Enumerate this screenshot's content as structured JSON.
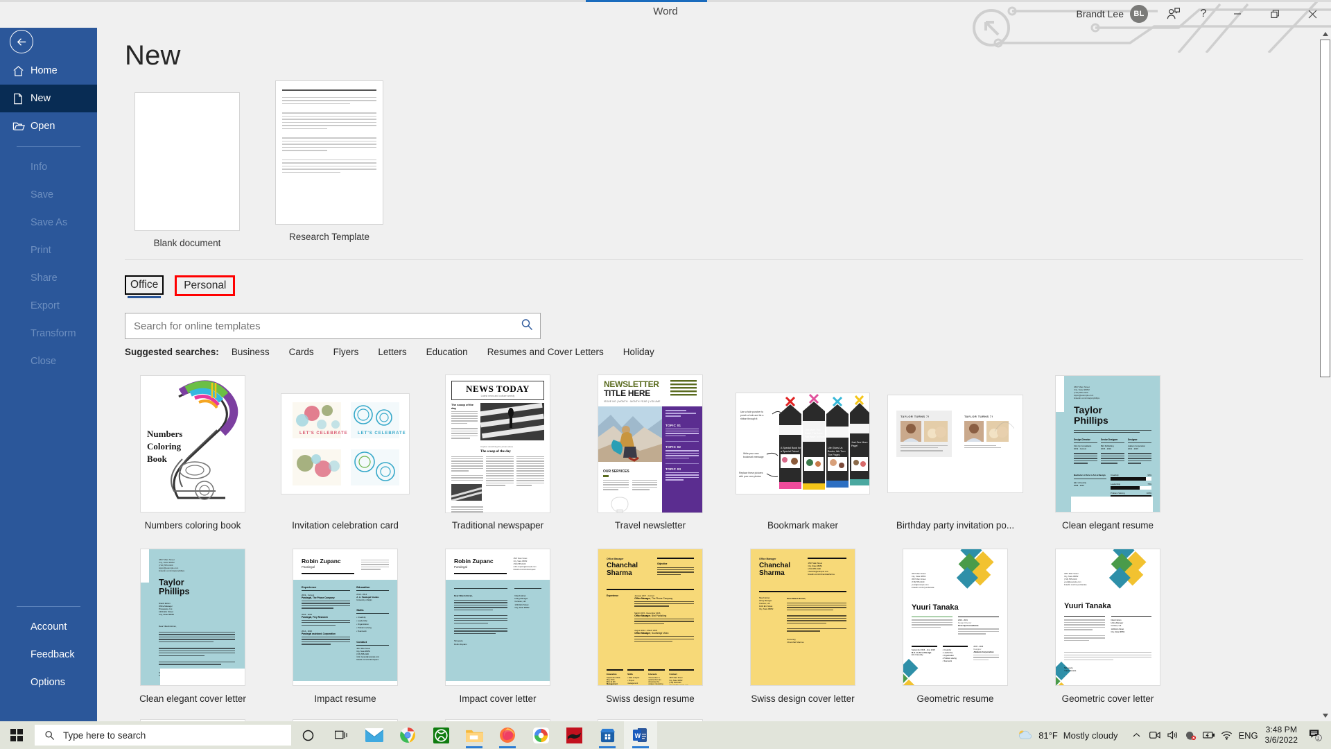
{
  "titlebar": {
    "app_title": "Word",
    "user_name": "Brandt Lee",
    "avatar_initials": "BL",
    "share_icon": "person-add-icon",
    "help_label": "?",
    "minimize_label": "—",
    "restore_label": "❐",
    "close_label": "✕"
  },
  "nav": {
    "back_icon": "back-arrow-icon",
    "items": [
      {
        "label": "Home",
        "icon": "home-icon",
        "state": "enabled"
      },
      {
        "label": "New",
        "icon": "new-document-icon",
        "state": "active"
      },
      {
        "label": "Open",
        "icon": "open-folder-icon",
        "state": "enabled"
      }
    ],
    "dim_items": [
      {
        "label": "Info"
      },
      {
        "label": "Save"
      },
      {
        "label": "Save As"
      },
      {
        "label": "Print"
      },
      {
        "label": "Share"
      },
      {
        "label": "Export"
      },
      {
        "label": "Transform"
      },
      {
        "label": "Close"
      }
    ],
    "bottom_items": [
      {
        "label": "Account"
      },
      {
        "label": "Feedback"
      },
      {
        "label": "Options"
      }
    ]
  },
  "main": {
    "page_title": "New",
    "featured": [
      {
        "name": "Blank document",
        "kind": "blank"
      },
      {
        "name": "Research Template",
        "kind": "lined"
      }
    ],
    "tabs": [
      {
        "label": "Office",
        "selected": true,
        "annotated": false
      },
      {
        "label": "Personal",
        "selected": false,
        "annotated": true
      }
    ],
    "search": {
      "value": "",
      "placeholder": "Search for online templates",
      "icon": "search-icon"
    },
    "suggested": {
      "label": "Suggested searches:",
      "items": [
        "Business",
        "Cards",
        "Flyers",
        "Letters",
        "Education",
        "Resumes and Cover Letters",
        "Holiday"
      ]
    },
    "templates": [
      {
        "name": "Numbers coloring book",
        "art": "coloring"
      },
      {
        "name": "Invitation celebration card",
        "art": "invitation"
      },
      {
        "name": "Traditional newspaper",
        "art": "newspaper"
      },
      {
        "name": "Travel newsletter",
        "art": "newsletter"
      },
      {
        "name": "Bookmark maker",
        "art": "bookmark"
      },
      {
        "name": "Birthday party invitation po...",
        "art": "birthday"
      },
      {
        "name": "Clean elegant resume",
        "art": "clean-resume"
      },
      {
        "name": "Clean elegant cover letter",
        "art": "clean-cover"
      },
      {
        "name": "Impact resume",
        "art": "impact-resume"
      },
      {
        "name": "Impact cover letter",
        "art": "impact-cover"
      },
      {
        "name": "Swiss design resume",
        "art": "swiss-resume"
      },
      {
        "name": "Swiss design cover letter",
        "art": "swiss-cover"
      },
      {
        "name": "Geometric resume",
        "art": "geo-resume"
      },
      {
        "name": "Geometric cover letter",
        "art": "geo-cover"
      }
    ],
    "thumb_text": {
      "coloring_l1": "Numbers",
      "coloring_l2": "Coloring",
      "coloring_l3": "Book",
      "invitation_text": "LET'S CELEBRATE",
      "newspaper_masthead": "NEWS TODAY",
      "newspaper_head": "The scoop of the day",
      "newsletter_l1": "NEWSLETTER",
      "newsletter_l2": "TITLE HERE",
      "newsletter_meta": "ISSUE NO | MONTH · MONTH YEAR | VOLUME",
      "newsletter_topic1": "TOPIC 01",
      "newsletter_topic2": "TOPIC 02",
      "newsletter_topic3": "TOPIC 03",
      "newsletter_services": "OUR SERVICES",
      "birthday_title": "TAYLOR TURNS 7!",
      "resume_name1": "Taylor",
      "resume_name2": "Phillips",
      "impact_name": "Robin Zupanc",
      "impact_role": "Paralegal",
      "swiss_pre": "Office Manager",
      "swiss_name1": "Chanchal",
      "swiss_name2": "Sharma",
      "geo_name": "Yuuri Tanaka"
    },
    "scrollbar": {
      "up_icon": "chevron-up-icon",
      "down_icon": "chevron-down-icon"
    }
  },
  "taskbar": {
    "start_icon": "windows-start-icon",
    "search_placeholder": "Type here to search",
    "search_icon": "search-icon",
    "cortana_icon": "cortana-circle-icon",
    "taskview_icon": "task-view-icon",
    "apps": [
      {
        "name": "mail-icon",
        "running": false,
        "active": false
      },
      {
        "name": "chrome-icon",
        "running": false,
        "active": false
      },
      {
        "name": "xbox-icon",
        "running": false,
        "active": false
      },
      {
        "name": "file-explorer-icon",
        "running": true,
        "active": false
      },
      {
        "name": "firefox-icon",
        "running": true,
        "active": false
      },
      {
        "name": "creative-cloud-icon",
        "running": false,
        "active": false
      },
      {
        "name": "red-app-icon",
        "running": false,
        "active": false
      },
      {
        "name": "microsoft-store-icon",
        "running": true,
        "active": false
      },
      {
        "name": "word-icon",
        "running": true,
        "active": true
      }
    ],
    "tray": {
      "weather_icon": "partly-cloudy-icon",
      "temperature": "81°F",
      "condition": "Mostly cloudy",
      "overflow_icon": "chevron-up-icon",
      "icons": [
        "camera-icon",
        "volume-icon",
        "mic-muted-icon",
        "battery-icon",
        "wifi-icon"
      ],
      "language": "ENG",
      "time": "3:48 PM",
      "date": "3/6/2022",
      "notification_icon": "notification-icon",
      "notification_count": "2"
    }
  }
}
